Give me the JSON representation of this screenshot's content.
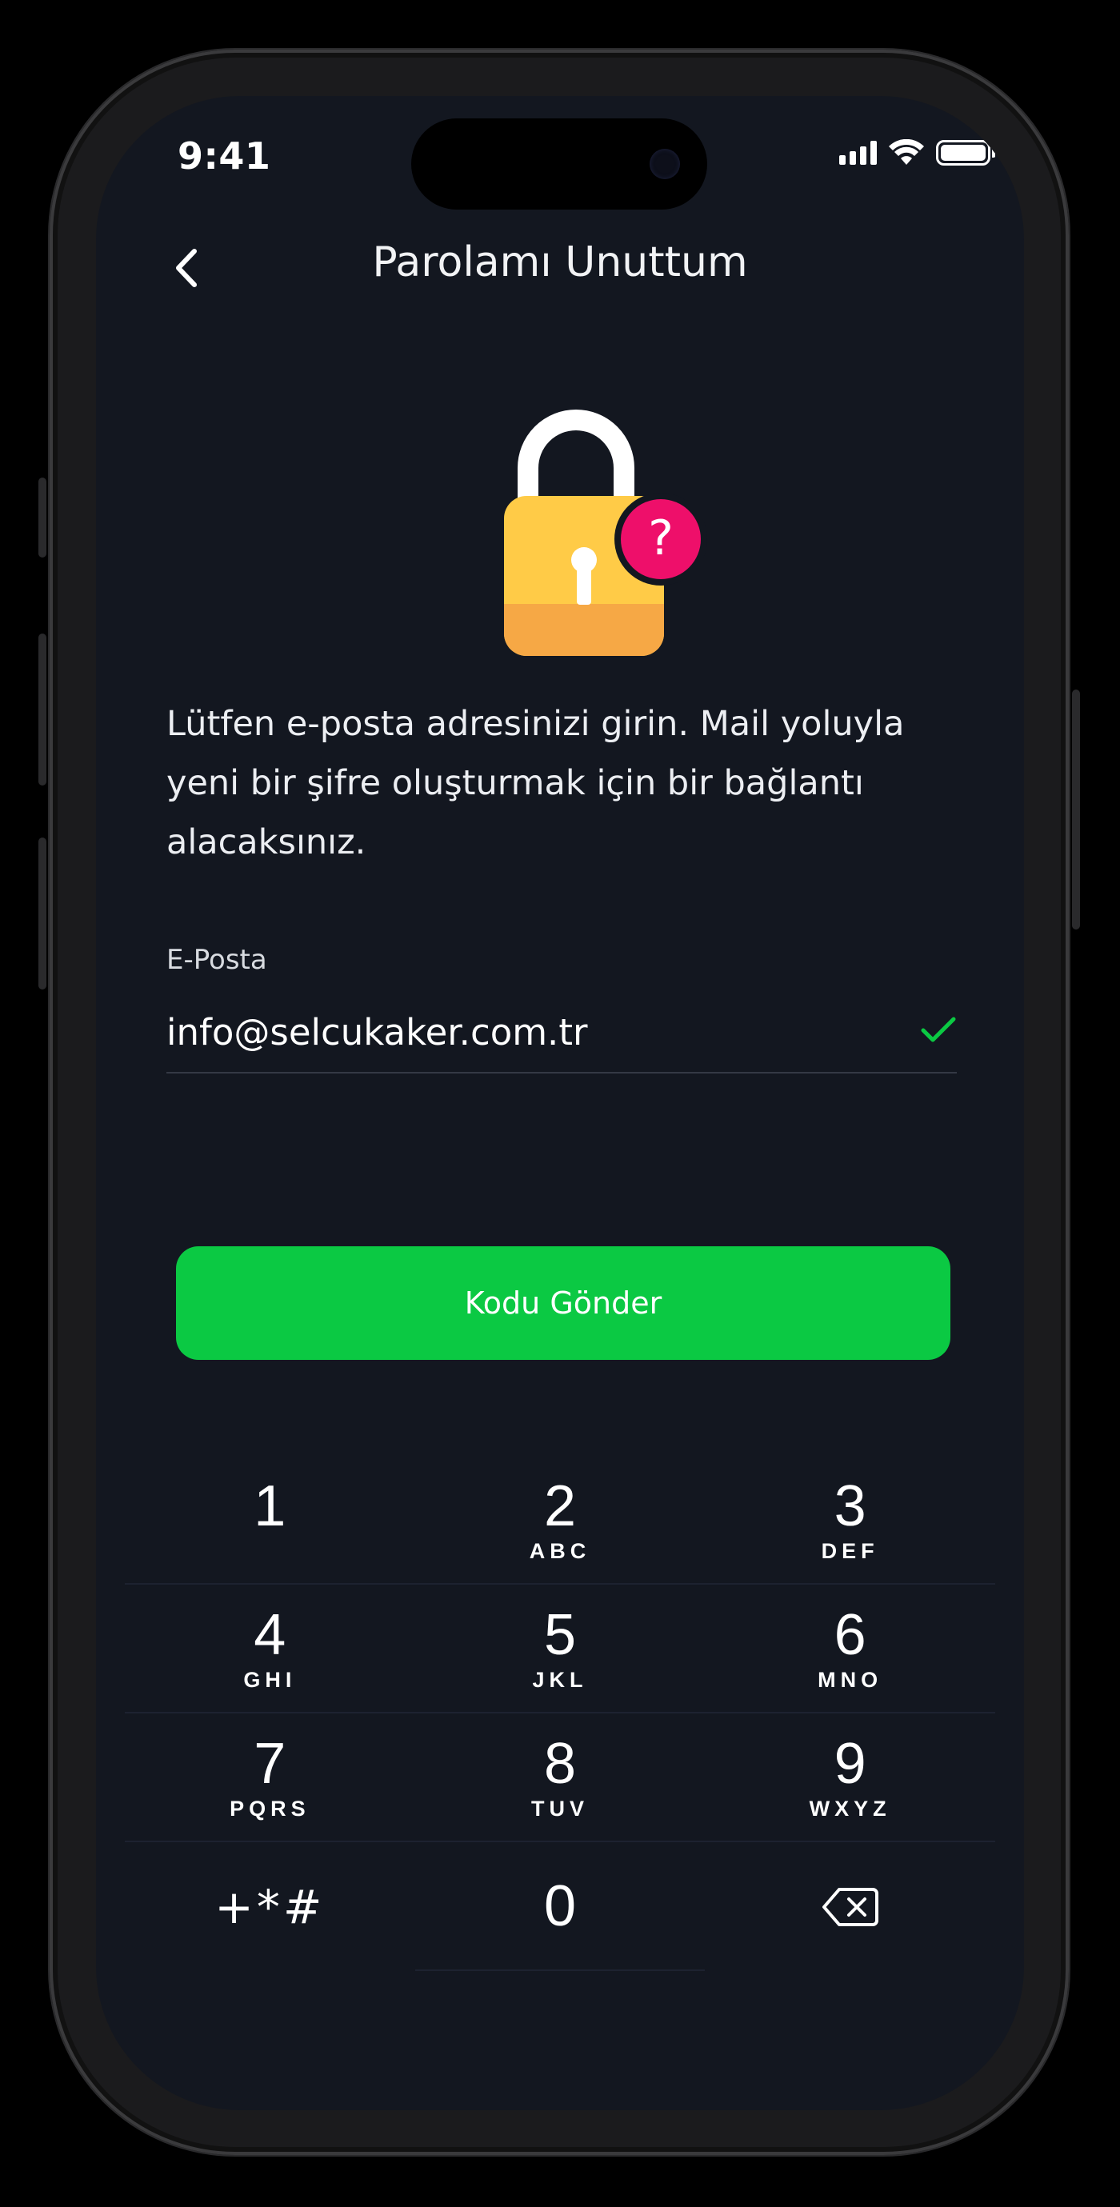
{
  "status_bar": {
    "time": "9:41"
  },
  "header": {
    "title": "Parolamı Unuttum",
    "back_icon": "chevron-left-icon"
  },
  "illustration": {
    "icon": "lock-question-icon",
    "colors": {
      "lock_body": "#FFCB47",
      "lock_base": "#F6A845",
      "badge": "#EE0F6A"
    }
  },
  "intro": {
    "text": "Lütfen e-posta adresinizi girin. Mail yoluyla yeni bir şifre oluşturmak için bir bağlantı alacaksınız."
  },
  "email": {
    "label": "E-Posta",
    "value": "info@selcukaker.com.tr",
    "valid_icon": "checkmark-icon"
  },
  "actions": {
    "send_label": "Kodu Gönder",
    "accent": "#0BC943"
  },
  "keypad": {
    "keys": [
      {
        "digit": "1",
        "letters": ""
      },
      {
        "digit": "2",
        "letters": "ABC"
      },
      {
        "digit": "3",
        "letters": "DEF"
      },
      {
        "digit": "4",
        "letters": "GHI"
      },
      {
        "digit": "5",
        "letters": "JKL"
      },
      {
        "digit": "6",
        "letters": "MNO"
      },
      {
        "digit": "7",
        "letters": "PQRS"
      },
      {
        "digit": "8",
        "letters": "TUV"
      },
      {
        "digit": "9",
        "letters": "WXYZ"
      }
    ],
    "symbols": "+*#",
    "zero": "0",
    "delete_icon": "backspace-icon"
  },
  "colors": {
    "background": "#131720",
    "text": "#FFFFFF"
  }
}
